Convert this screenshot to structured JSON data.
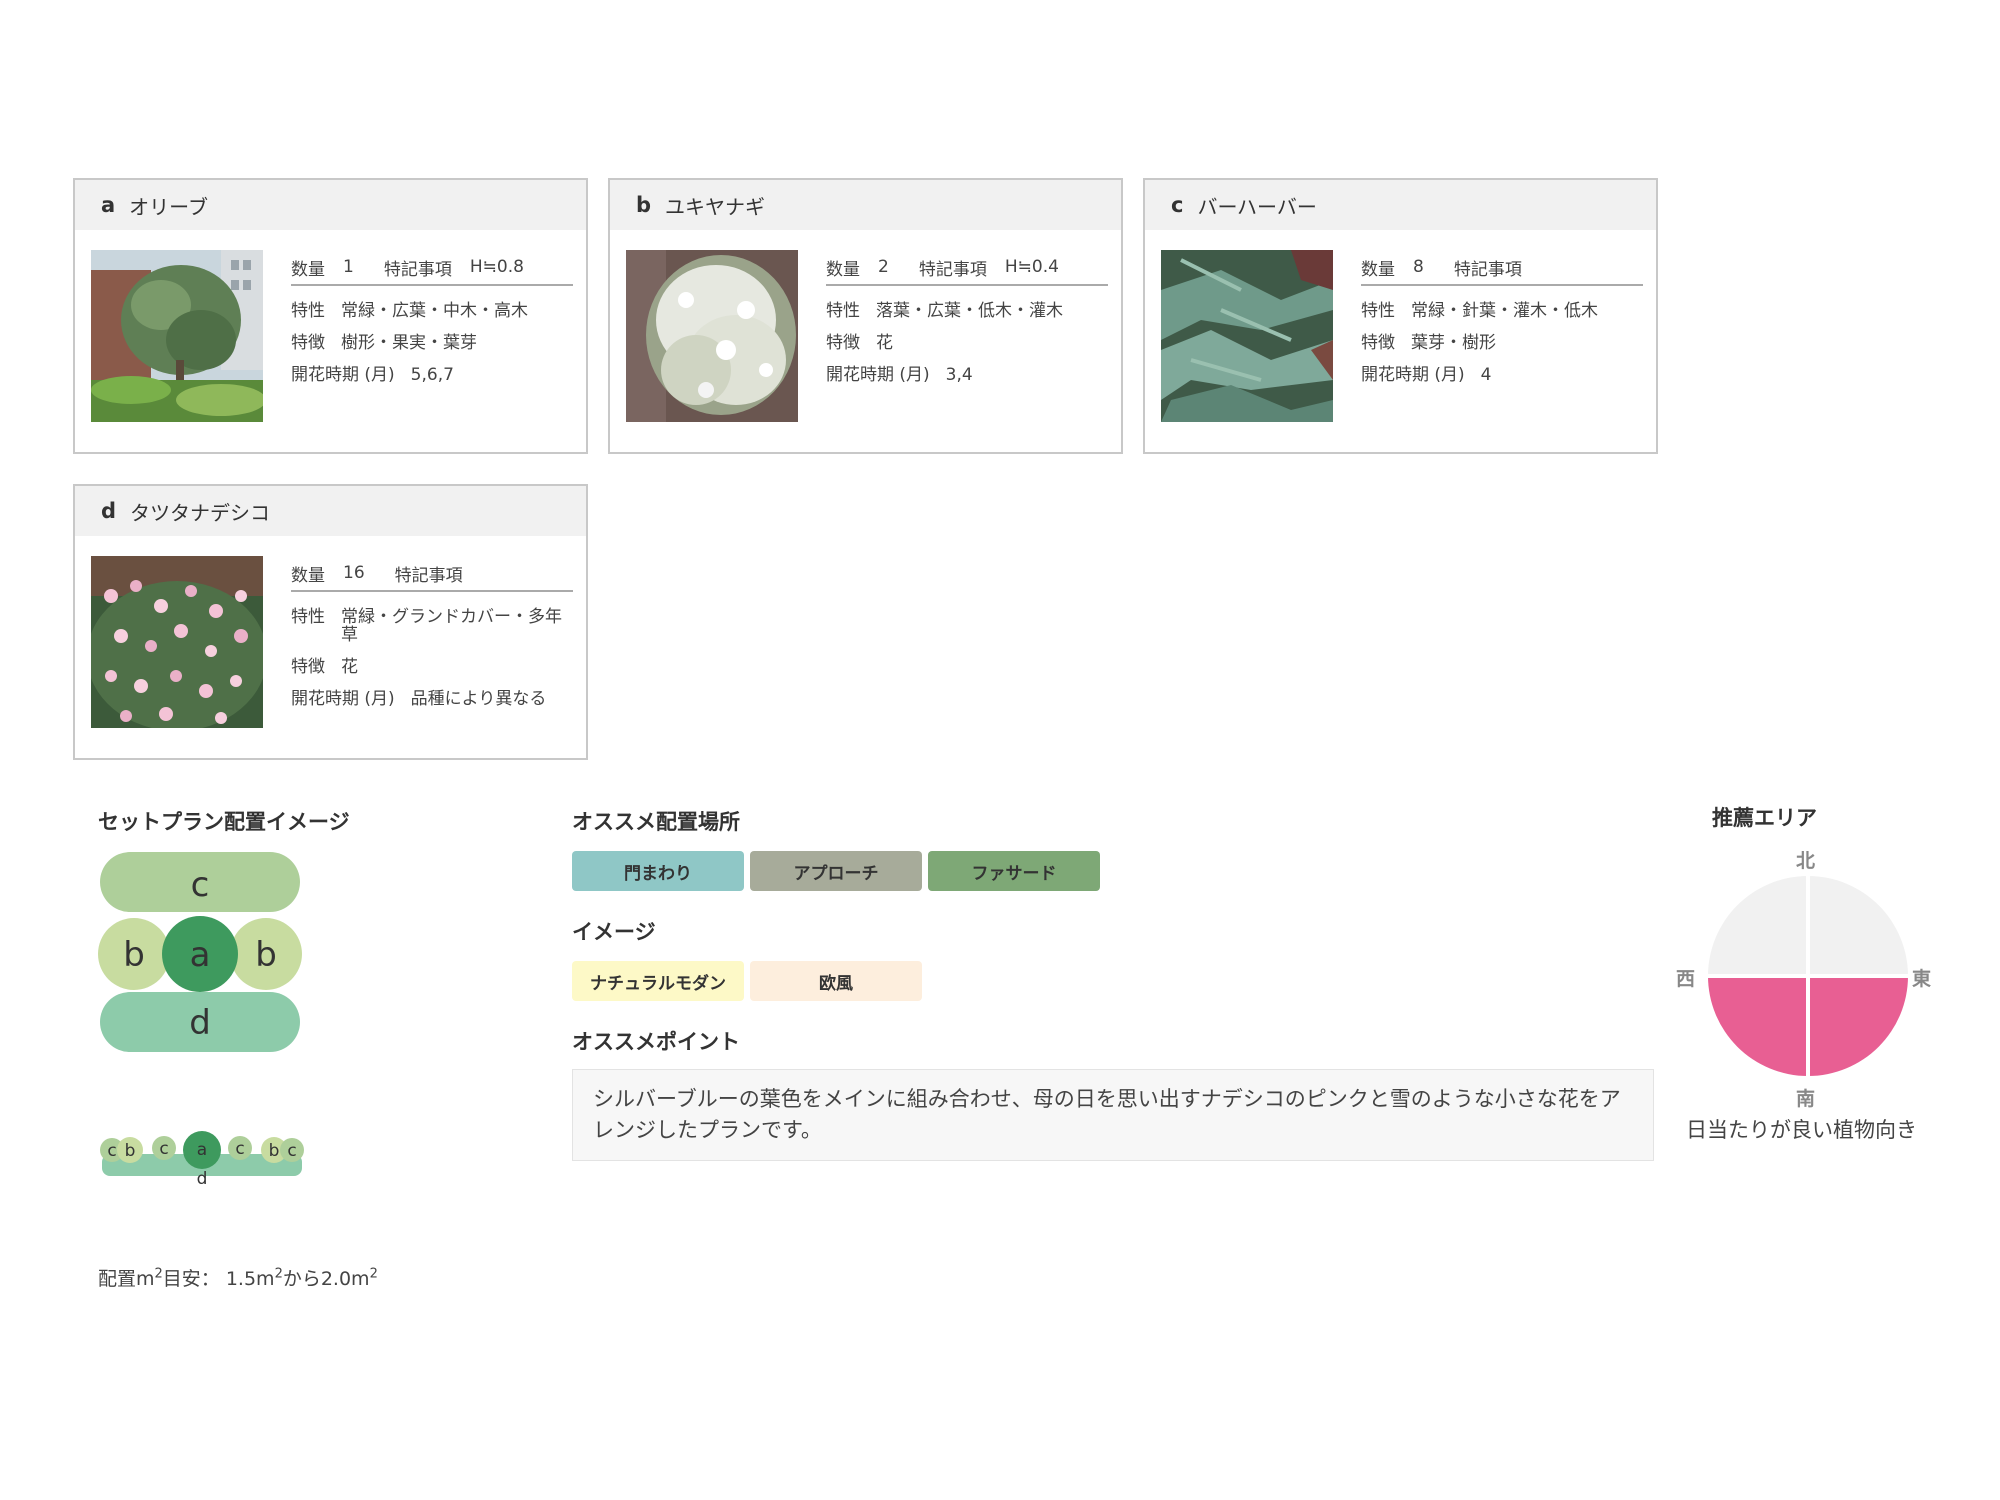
{
  "plants": [
    {
      "letter": "a",
      "name": "オリーブ",
      "qty_label": "数量",
      "qty": "1",
      "note_label": "特記事項",
      "note": "H≒0.8",
      "trait_label": "特性",
      "trait": "常緑・広葉・中木・高木",
      "feature_label": "特徴",
      "feature": "樹形・果実・葉芽",
      "bloom_label": "開花時期 (月)",
      "bloom": "5,6,7",
      "photo_icon": "olive-tree-photo"
    },
    {
      "letter": "b",
      "name": "ユキヤナギ",
      "qty_label": "数量",
      "qty": "2",
      "note_label": "特記事項",
      "note": "H≒0.4",
      "trait_label": "特性",
      "trait": "落葉・広葉・低木・灌木",
      "feature_label": "特徴",
      "feature": "花",
      "bloom_label": "開花時期 (月)",
      "bloom": "3,4",
      "photo_icon": "white-flowering-shrub-photo"
    },
    {
      "letter": "c",
      "name": "バーハーバー",
      "qty_label": "数量",
      "qty": "8",
      "note_label": "特記事項",
      "note": "",
      "trait_label": "特性",
      "trait": "常緑・針葉・灌木・低木",
      "feature_label": "特徴",
      "feature": "葉芽・樹形",
      "bloom_label": "開花時期 (月)",
      "bloom": "4",
      "photo_icon": "juniper-photo"
    },
    {
      "letter": "d",
      "name": "タツタナデシコ",
      "qty_label": "数量",
      "qty": "16",
      "note_label": "特記事項",
      "note": "",
      "trait_label": "特性",
      "trait": "常緑・グランドカバー・多年草",
      "feature_label": "特徴",
      "feature": "花",
      "bloom_label": "開花時期 (月)",
      "bloom": "品種により異なる",
      "photo_icon": "pink-dianthus-photo"
    }
  ],
  "layout_image": {
    "title": "セットプラン配置イメージ",
    "big_labels": [
      "c",
      "b",
      "a",
      "b",
      "d"
    ],
    "small_labels": [
      "c",
      "b",
      "c",
      "a",
      "c",
      "b",
      "c",
      "d"
    ],
    "area_prefix": "配置m",
    "area_sup1": "2",
    "area_mid": "目安： 1.5m",
    "area_sup2": "2",
    "area_mid2": "から2.0m",
    "area_sup3": "2"
  },
  "recommend": {
    "place_title": "オススメ配置場所",
    "places": [
      {
        "label": "門まわり",
        "color": "#8fc7c6"
      },
      {
        "label": "アプローチ",
        "color": "#a7ab9a"
      },
      {
        "label": "ファサード",
        "color": "#7ea876"
      }
    ],
    "image_title": "イメージ",
    "images": [
      {
        "label": "ナチュラルモダン",
        "color": "#fdf9c7"
      },
      {
        "label": "欧風",
        "color": "#fdeedd"
      }
    ],
    "point_title": "オススメポイント",
    "point_text": "シルバーブルーの葉色をメインに組み合わせ、母の日を思い出すナデシコのピンクと雪のような小さな花をアレンジしたプランです。"
  },
  "area": {
    "title": "推薦エリア",
    "north": "北",
    "south": "南",
    "east": "東",
    "west": "西",
    "caption": "日当たりが良い植物向き",
    "sunny_color": "#e85f93",
    "shade_color": "#f1f1f1",
    "highlighted_quadrants": [
      "south-west",
      "south-east"
    ]
  }
}
